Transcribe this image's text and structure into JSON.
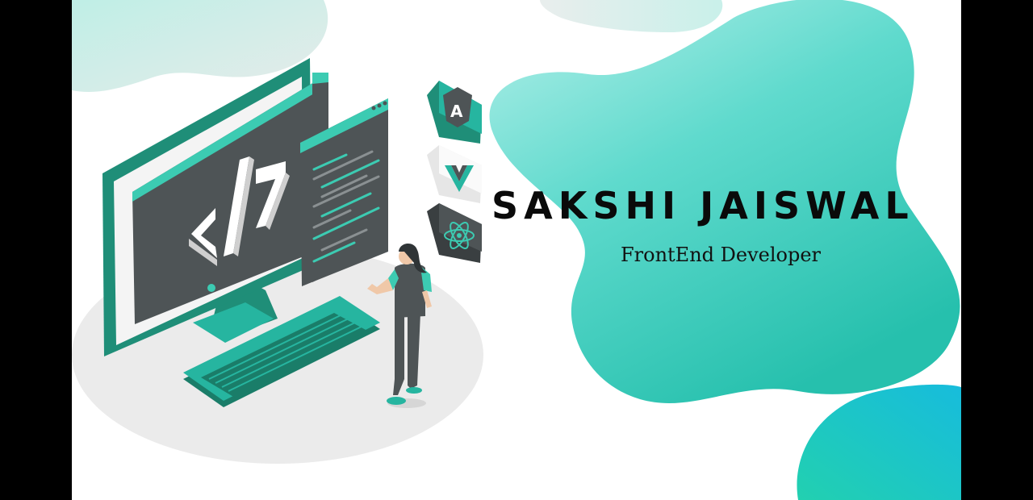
{
  "profile": {
    "name": "SAKSHI JAISWAL",
    "role": "FrontEnd Developer"
  },
  "illustration": {
    "monitor_code_label": "</>",
    "tech_icons": [
      "angular-icon",
      "vue-icon",
      "react-icon"
    ]
  },
  "colors": {
    "accent": "#26b5a0",
    "accent_dark": "#1a8f7a",
    "blob_light": "#a9ece4",
    "blob_mid": "#43d1c4",
    "blob_blue": "#15c5d8",
    "screen_gray": "#4e5456",
    "frame_green": "#1f8e78"
  }
}
